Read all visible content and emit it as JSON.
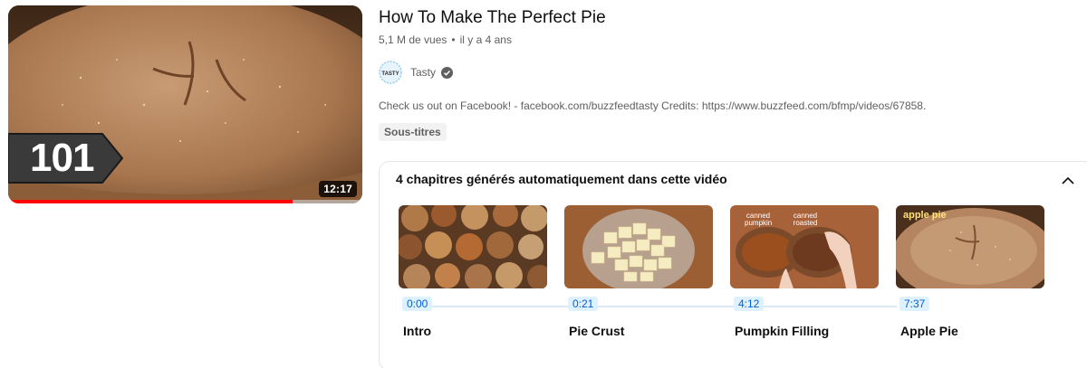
{
  "video": {
    "title": "How To Make The Perfect Pie",
    "views": "5,1 M de vues",
    "age": "il y a 4 ans",
    "duration": "12:17",
    "badge_text": "101",
    "watch_progress": 0.804
  },
  "channel": {
    "name": "Tasty",
    "avatar_text": "TASTY",
    "verified_icon": "verified-check-icon"
  },
  "description": "Check us out on Facebook! - facebook.com/buzzfeedtasty Credits: https://www.buzzfeed.com/bfmp/videos/67858.",
  "chip": "Sous-titres",
  "chapters_panel": {
    "header": "4 chapitres générés automatiquement dans cette vidéo",
    "collapse_icon": "chevron-up-icon",
    "chapters": [
      {
        "time": "0:00",
        "title": "Intro"
      },
      {
        "time": "0:21",
        "title": "Pie Crust"
      },
      {
        "time": "4:12",
        "title": "Pumpkin Filling",
        "labels": [
          "canned pumpkin",
          "canned roasted"
        ]
      },
      {
        "time": "7:37",
        "title": "Apple Pie",
        "overlay": "apple pie"
      }
    ]
  },
  "colors": {
    "progress": "#ff0000",
    "time_chip_bg": "#def1ff",
    "time_chip_text": "#065fd4"
  }
}
